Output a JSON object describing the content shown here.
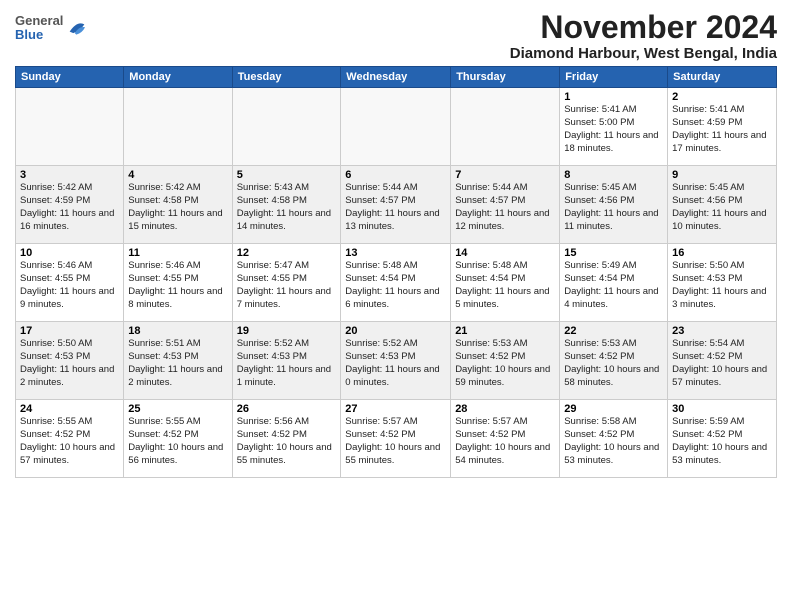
{
  "header": {
    "logo_general": "General",
    "logo_blue": "Blue",
    "month": "November 2024",
    "location": "Diamond Harbour, West Bengal, India"
  },
  "weekdays": [
    "Sunday",
    "Monday",
    "Tuesday",
    "Wednesday",
    "Thursday",
    "Friday",
    "Saturday"
  ],
  "weeks": [
    [
      {
        "day": "",
        "empty": true
      },
      {
        "day": "",
        "empty": true
      },
      {
        "day": "",
        "empty": true
      },
      {
        "day": "",
        "empty": true
      },
      {
        "day": "",
        "empty": true
      },
      {
        "day": "1",
        "info": "Sunrise: 5:41 AM\nSunset: 5:00 PM\nDaylight: 11 hours\nand 18 minutes."
      },
      {
        "day": "2",
        "info": "Sunrise: 5:41 AM\nSunset: 4:59 PM\nDaylight: 11 hours\nand 17 minutes."
      }
    ],
    [
      {
        "day": "3",
        "info": "Sunrise: 5:42 AM\nSunset: 4:59 PM\nDaylight: 11 hours\nand 16 minutes."
      },
      {
        "day": "4",
        "info": "Sunrise: 5:42 AM\nSunset: 4:58 PM\nDaylight: 11 hours\nand 15 minutes."
      },
      {
        "day": "5",
        "info": "Sunrise: 5:43 AM\nSunset: 4:58 PM\nDaylight: 11 hours\nand 14 minutes."
      },
      {
        "day": "6",
        "info": "Sunrise: 5:44 AM\nSunset: 4:57 PM\nDaylight: 11 hours\nand 13 minutes."
      },
      {
        "day": "7",
        "info": "Sunrise: 5:44 AM\nSunset: 4:57 PM\nDaylight: 11 hours\nand 12 minutes."
      },
      {
        "day": "8",
        "info": "Sunrise: 5:45 AM\nSunset: 4:56 PM\nDaylight: 11 hours\nand 11 minutes."
      },
      {
        "day": "9",
        "info": "Sunrise: 5:45 AM\nSunset: 4:56 PM\nDaylight: 11 hours\nand 10 minutes."
      }
    ],
    [
      {
        "day": "10",
        "info": "Sunrise: 5:46 AM\nSunset: 4:55 PM\nDaylight: 11 hours\nand 9 minutes."
      },
      {
        "day": "11",
        "info": "Sunrise: 5:46 AM\nSunset: 4:55 PM\nDaylight: 11 hours\nand 8 minutes."
      },
      {
        "day": "12",
        "info": "Sunrise: 5:47 AM\nSunset: 4:55 PM\nDaylight: 11 hours\nand 7 minutes."
      },
      {
        "day": "13",
        "info": "Sunrise: 5:48 AM\nSunset: 4:54 PM\nDaylight: 11 hours\nand 6 minutes."
      },
      {
        "day": "14",
        "info": "Sunrise: 5:48 AM\nSunset: 4:54 PM\nDaylight: 11 hours\nand 5 minutes."
      },
      {
        "day": "15",
        "info": "Sunrise: 5:49 AM\nSunset: 4:54 PM\nDaylight: 11 hours\nand 4 minutes."
      },
      {
        "day": "16",
        "info": "Sunrise: 5:50 AM\nSunset: 4:53 PM\nDaylight: 11 hours\nand 3 minutes."
      }
    ],
    [
      {
        "day": "17",
        "info": "Sunrise: 5:50 AM\nSunset: 4:53 PM\nDaylight: 11 hours\nand 2 minutes."
      },
      {
        "day": "18",
        "info": "Sunrise: 5:51 AM\nSunset: 4:53 PM\nDaylight: 11 hours\nand 2 minutes."
      },
      {
        "day": "19",
        "info": "Sunrise: 5:52 AM\nSunset: 4:53 PM\nDaylight: 11 hours\nand 1 minute."
      },
      {
        "day": "20",
        "info": "Sunrise: 5:52 AM\nSunset: 4:53 PM\nDaylight: 11 hours\nand 0 minutes."
      },
      {
        "day": "21",
        "info": "Sunrise: 5:53 AM\nSunset: 4:52 PM\nDaylight: 10 hours\nand 59 minutes."
      },
      {
        "day": "22",
        "info": "Sunrise: 5:53 AM\nSunset: 4:52 PM\nDaylight: 10 hours\nand 58 minutes."
      },
      {
        "day": "23",
        "info": "Sunrise: 5:54 AM\nSunset: 4:52 PM\nDaylight: 10 hours\nand 57 minutes."
      }
    ],
    [
      {
        "day": "24",
        "info": "Sunrise: 5:55 AM\nSunset: 4:52 PM\nDaylight: 10 hours\nand 57 minutes."
      },
      {
        "day": "25",
        "info": "Sunrise: 5:55 AM\nSunset: 4:52 PM\nDaylight: 10 hours\nand 56 minutes."
      },
      {
        "day": "26",
        "info": "Sunrise: 5:56 AM\nSunset: 4:52 PM\nDaylight: 10 hours\nand 55 minutes."
      },
      {
        "day": "27",
        "info": "Sunrise: 5:57 AM\nSunset: 4:52 PM\nDaylight: 10 hours\nand 55 minutes."
      },
      {
        "day": "28",
        "info": "Sunrise: 5:57 AM\nSunset: 4:52 PM\nDaylight: 10 hours\nand 54 minutes."
      },
      {
        "day": "29",
        "info": "Sunrise: 5:58 AM\nSunset: 4:52 PM\nDaylight: 10 hours\nand 53 minutes."
      },
      {
        "day": "30",
        "info": "Sunrise: 5:59 AM\nSunset: 4:52 PM\nDaylight: 10 hours\nand 53 minutes."
      }
    ]
  ]
}
